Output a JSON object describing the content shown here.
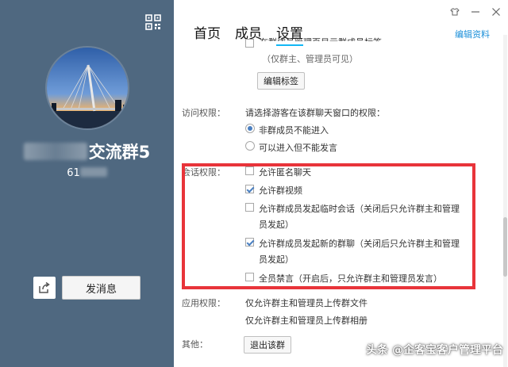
{
  "group": {
    "name_visible": "交流群5",
    "id_visible": "61"
  },
  "left": {
    "send_label": "发消息"
  },
  "tabs": [
    {
      "label": "首页"
    },
    {
      "label": "成员"
    },
    {
      "label": "设置",
      "active": true
    }
  ],
  "header": {
    "edit_link": "编辑资料"
  },
  "settings": {
    "member_tag_row_partial": "在群成员管理页显示群成员标签",
    "member_tag_note": "（仅群主、管理员可见）",
    "edit_tags_button": "编辑标签",
    "access": {
      "label": "访问权限：",
      "prompt": "请选择游客在该群聊天窗口的权限：",
      "options": [
        {
          "label": "非群成员不能进入",
          "selected": true
        },
        {
          "label": "可以进入但不能发言",
          "selected": false
        }
      ]
    },
    "session": {
      "label": "会话权限：",
      "options": [
        {
          "line1": "允许匿名聊天",
          "line2": "",
          "checked": false
        },
        {
          "line1": "允许群视频",
          "line2": "",
          "checked": true
        },
        {
          "line1": "允许群成员发起临时会话（关闭后只允许群主和管理",
          "line2": "员发起）",
          "checked": false
        },
        {
          "line1": "允许群成员发起新的群聊（关闭后只允许群主和管理",
          "line2": "员发起）",
          "checked": true
        },
        {
          "line1": "全员禁言（开启后，只允许群主和管理员发言）",
          "line2": "",
          "checked": false
        }
      ]
    },
    "apps": {
      "label": "应用权限：",
      "lines": [
        "仅允许群主和管理员上传群文件",
        "仅允许群主和管理员上传群相册"
      ]
    },
    "other": {
      "label": "其他：",
      "quit_button": "退出该群"
    }
  },
  "watermark": "头条 @企客宝客户管理平台",
  "colors": {
    "left_panel": "#4f6880",
    "accent": "#12b7f5",
    "link": "#1b8fd9",
    "highlight": "#e8343a"
  }
}
